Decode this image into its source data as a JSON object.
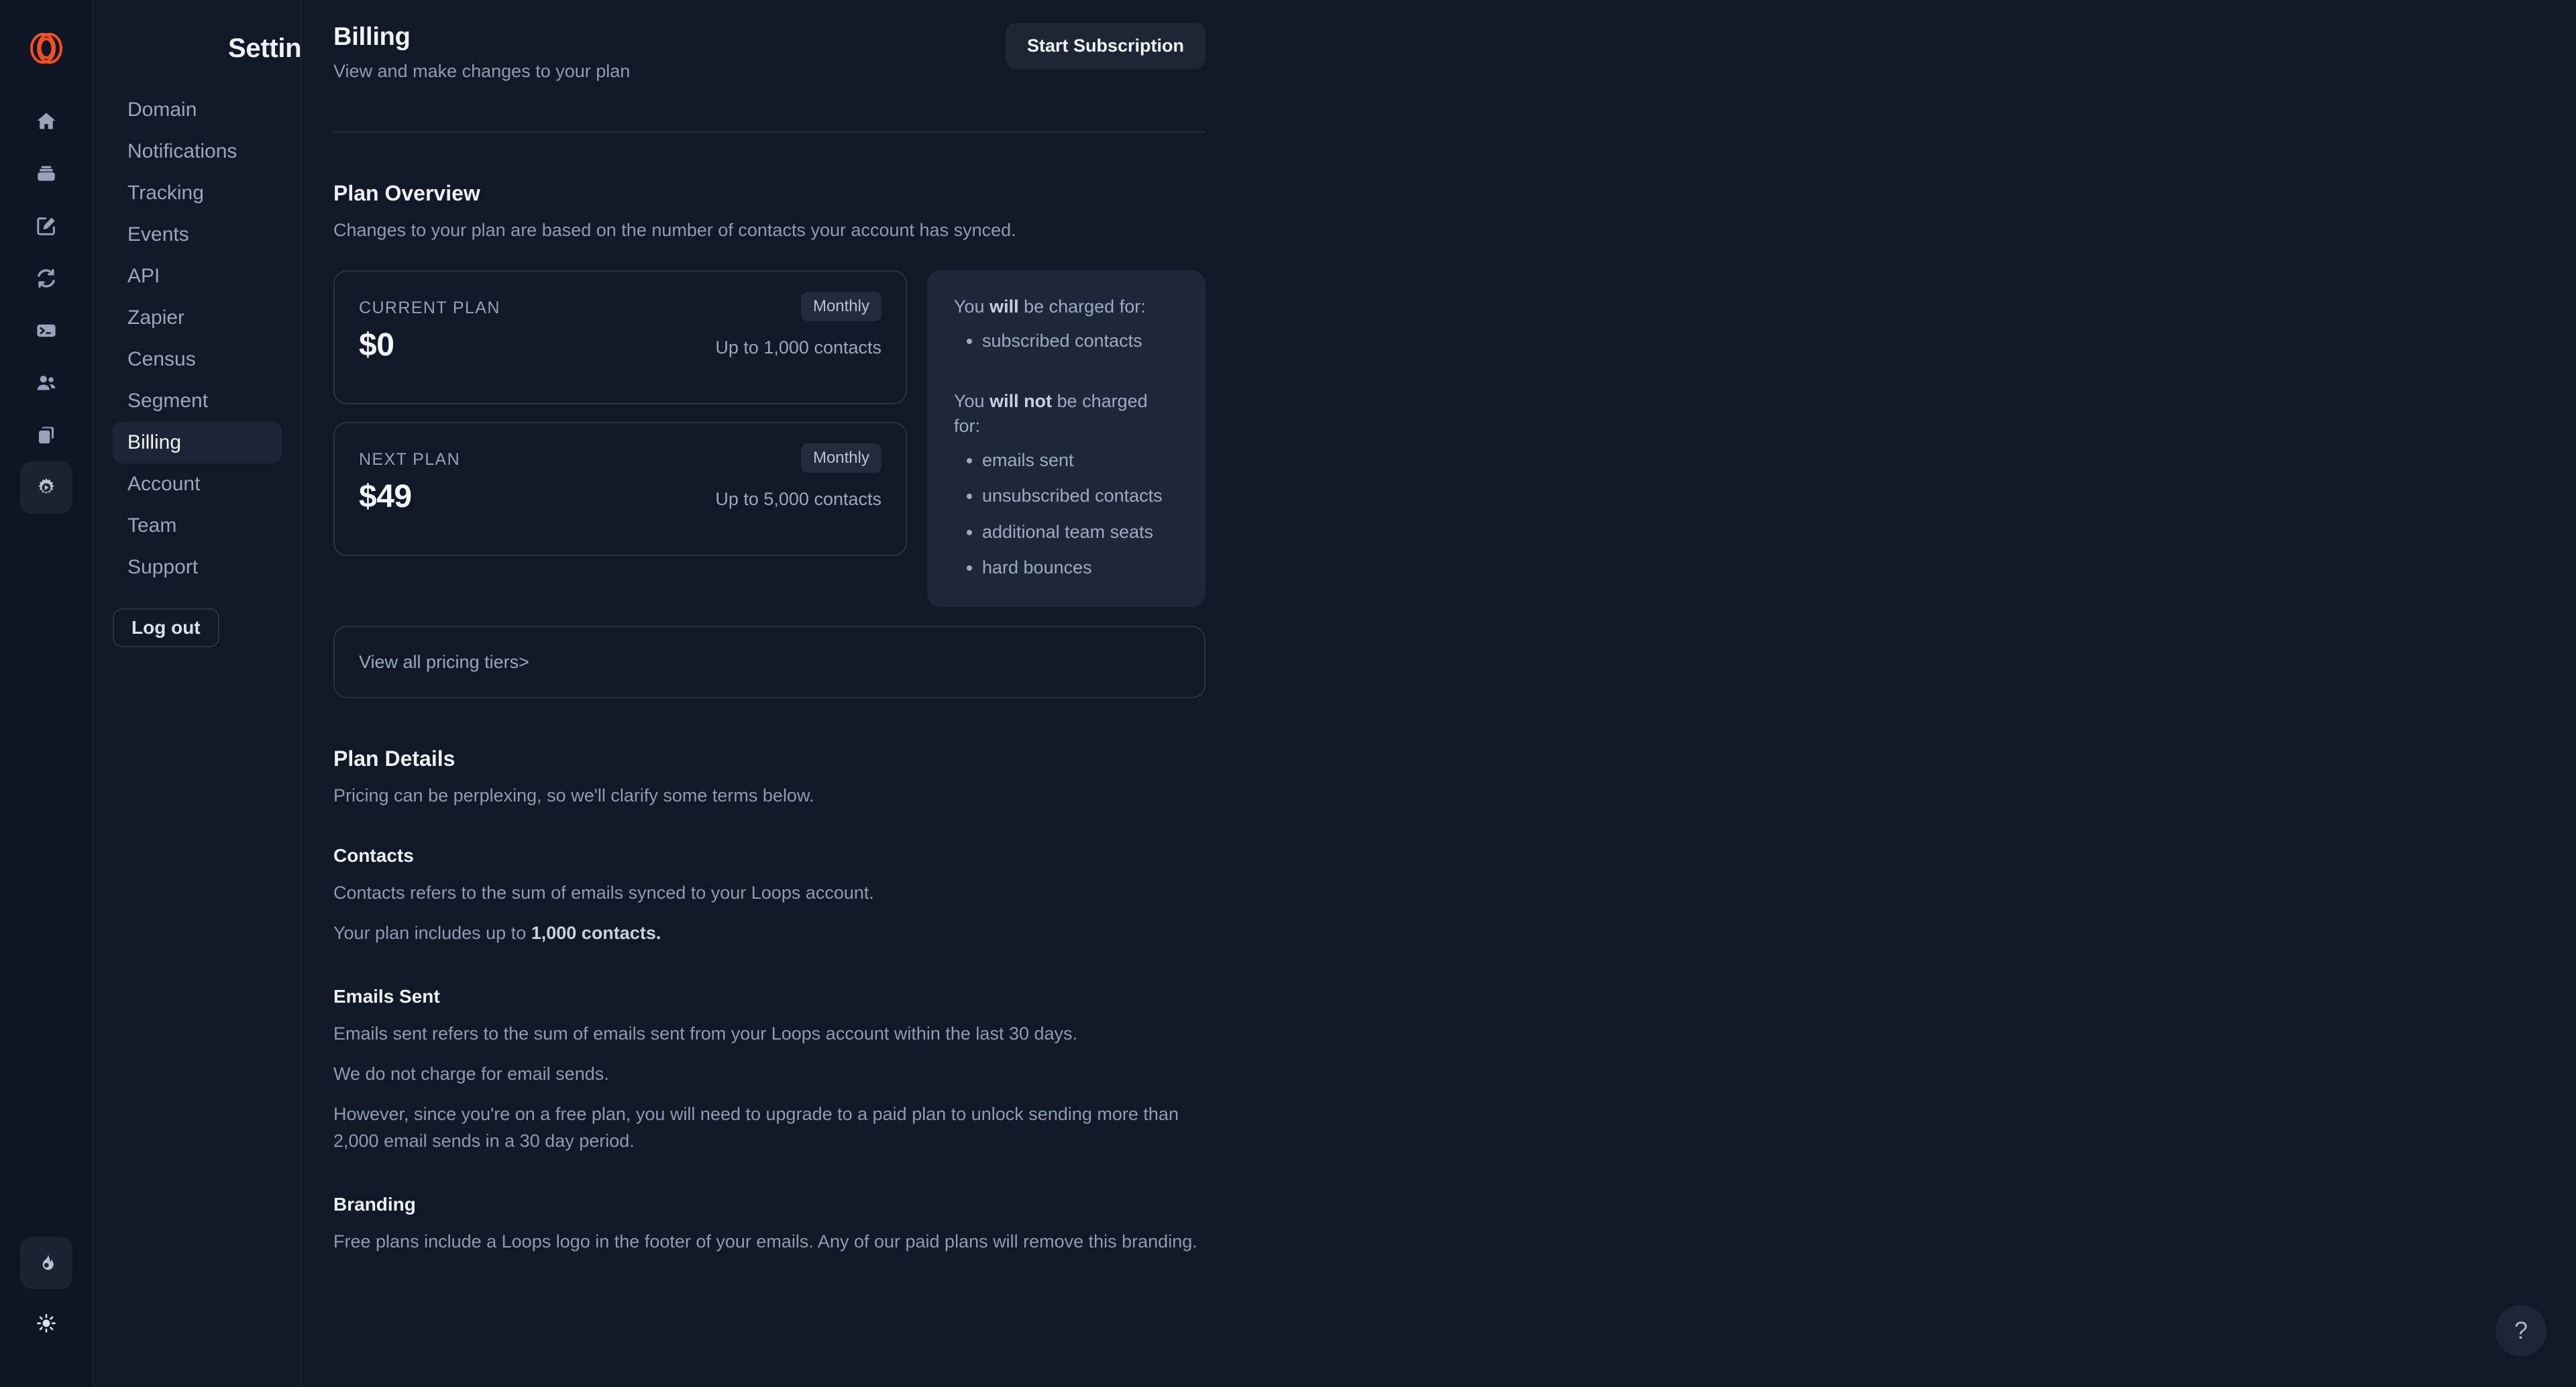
{
  "brand": {
    "logo_icon": "loops-logo-icon",
    "accent": "#f4501e"
  },
  "rail": {
    "items": [
      {
        "icon": "home-icon",
        "name": "home"
      },
      {
        "icon": "archive-icon",
        "name": "archive"
      },
      {
        "icon": "compose-icon",
        "name": "compose"
      },
      {
        "icon": "loops-sync-icon",
        "name": "loops"
      },
      {
        "icon": "terminal-icon",
        "name": "terminal"
      },
      {
        "icon": "audience-icon",
        "name": "audience"
      },
      {
        "icon": "templates-icon",
        "name": "templates"
      },
      {
        "icon": "gear-icon",
        "name": "settings",
        "active": true
      }
    ],
    "bottom": [
      {
        "icon": "flame-icon",
        "name": "whats-new",
        "active": true
      },
      {
        "icon": "sun-icon",
        "name": "theme-toggle",
        "active": false
      }
    ]
  },
  "sidebar": {
    "title": "Settings",
    "items": [
      {
        "label": "Domain",
        "active": false
      },
      {
        "label": "Notifications",
        "active": false
      },
      {
        "label": "Tracking",
        "active": false
      },
      {
        "label": "Events",
        "active": false
      },
      {
        "label": "API",
        "active": false
      },
      {
        "label": "Zapier",
        "active": false
      },
      {
        "label": "Census",
        "active": false
      },
      {
        "label": "Segment",
        "active": false
      },
      {
        "label": "Billing",
        "active": true
      },
      {
        "label": "Account",
        "active": false
      },
      {
        "label": "Team",
        "active": false
      },
      {
        "label": "Support",
        "active": false
      }
    ],
    "logout_label": "Log out"
  },
  "header": {
    "title": "Billing",
    "subtitle": "View and make changes to your plan",
    "action_label": "Start Subscription"
  },
  "plan_overview": {
    "title": "Plan Overview",
    "subtitle": "Changes to your plan are based on the number of contacts your account has synced.",
    "cards": [
      {
        "label": "CURRENT PLAN",
        "badge": "Monthly",
        "price": "$0",
        "limit": "Up to 1,000 contacts"
      },
      {
        "label": "NEXT PLAN",
        "badge": "Monthly",
        "price": "$49",
        "limit": "Up to 5,000 contacts"
      }
    ],
    "charged": {
      "will_prefix": "You ",
      "will_bold": "will",
      "will_suffix": " be charged for:",
      "will_items": [
        "subscribed contacts"
      ],
      "wont_prefix": "You ",
      "wont_bold": "will not",
      "wont_suffix": " be charged for:",
      "wont_items": [
        "emails sent",
        "unsubscribed contacts",
        "additional team seats",
        "hard bounces"
      ]
    },
    "tiers_link": "View all pricing tiers",
    "tiers_chevron": ">"
  },
  "plan_details": {
    "title": "Plan Details",
    "subtitle": "Pricing can be perplexing, so we'll clarify some terms below.",
    "sections": [
      {
        "heading": "Contacts",
        "p1": "Contacts refers to the sum of emails synced to your Loops account.",
        "p2_prefix": "Your plan includes up to ",
        "p2_bold": "1,000 contacts.",
        "p2_suffix": ""
      },
      {
        "heading": "Emails Sent",
        "p1": "Emails sent refers to the sum of emails sent from your Loops account within the last 30 days.",
        "p2": "We do not charge for email sends.",
        "p3": "However, since you're on a free plan, you will need to upgrade to a paid plan to unlock sending more than 2,000 email sends in a 30 day period."
      },
      {
        "heading": "Branding",
        "p1": "Free plans include a Loops logo in the footer of your emails. Any of our paid plans will remove this branding."
      }
    ]
  },
  "help": {
    "label": "?"
  }
}
